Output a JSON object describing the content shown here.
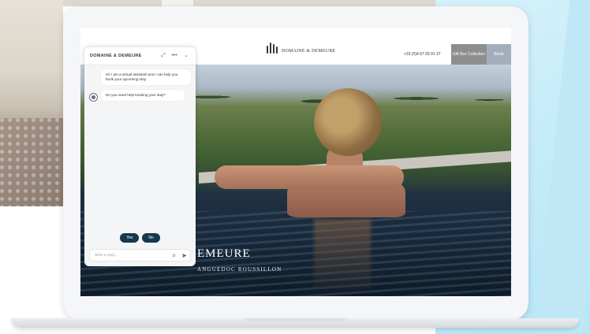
{
  "site": {
    "logo_text": "DOMAINE & DEMEURE",
    "phone": "+33 (0)4 67 93 91 37",
    "gift_box": "Gift Box Collection",
    "book": "Book",
    "hero_title": "EMEURE",
    "hero_subtitle": "ANGUEDOC ROUSSILLON"
  },
  "chat": {
    "title": "DOMAINE & DEMEURE",
    "icons": [
      "expand-icon",
      "more-icon",
      "chevron-down-icon"
    ],
    "messages": [
      "Hi! I am a virtual assistant and I can help you book your upcoming stay.",
      "Do you need help booking your stay?"
    ],
    "quick_replies": [
      "Yes",
      "No"
    ],
    "composer_placeholder": "Write a reply..."
  },
  "colors": {
    "accent_dark": "#15384e",
    "gift_btn": "#8e8e8e",
    "book_btn": "#a3aebc"
  }
}
